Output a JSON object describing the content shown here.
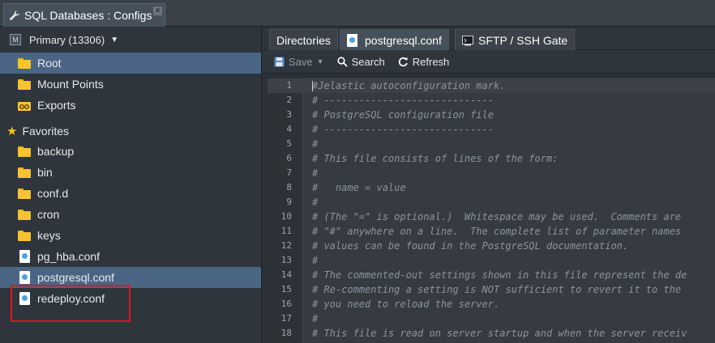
{
  "window_tab": {
    "title": "SQL Databases : Configs",
    "close": "×"
  },
  "node": {
    "label": "Primary (13306)",
    "badge": "M"
  },
  "nav": [
    {
      "label": "Root",
      "icon": "folder-icon",
      "selected": true
    },
    {
      "label": "Mount Points",
      "icon": "folder-icon"
    },
    {
      "label": "Exports",
      "icon": "exports-icon"
    }
  ],
  "favorites": {
    "label": "Favorites",
    "items": [
      {
        "label": "backup",
        "type": "folder"
      },
      {
        "label": "bin",
        "type": "folder"
      },
      {
        "label": "conf.d",
        "type": "folder"
      },
      {
        "label": "cron",
        "type": "folder"
      },
      {
        "label": "keys",
        "type": "folder"
      },
      {
        "label": "pg_hba.conf",
        "type": "file"
      },
      {
        "label": "postgresql.conf",
        "type": "file",
        "selected": true
      },
      {
        "label": "redeploy.conf",
        "type": "file"
      }
    ]
  },
  "tabs": [
    {
      "label": "Directories"
    },
    {
      "label": "postgresql.conf",
      "active": true
    },
    {
      "label": "SFTP / SSH Gate"
    }
  ],
  "toolbar": {
    "save": "Save",
    "search": "Search",
    "refresh": "Refresh"
  },
  "editor": {
    "lines": [
      "#Jelastic autoconfiguration mark.",
      "# -----------------------------",
      "# PostgreSQL configuration file",
      "# -----------------------------",
      "#",
      "# This file consists of lines of the form:",
      "#",
      "#   name = value",
      "#",
      "# (The \"=\" is optional.)  Whitespace may be used.  Comments are",
      "# \"#\" anywhere on a line.  The complete list of parameter names",
      "# values can be found in the PostgreSQL documentation.",
      "#",
      "# The commented-out settings shown in this file represent the de",
      "# Re-commenting a setting is NOT sufficient to revert it to the",
      "# you need to reload the server.",
      "#",
      "# This file is read on server startup and when the server receiv"
    ]
  },
  "colors": {
    "accent": "#4b6684",
    "highlight_box": "#e3131b",
    "folder": "#f7c331"
  }
}
